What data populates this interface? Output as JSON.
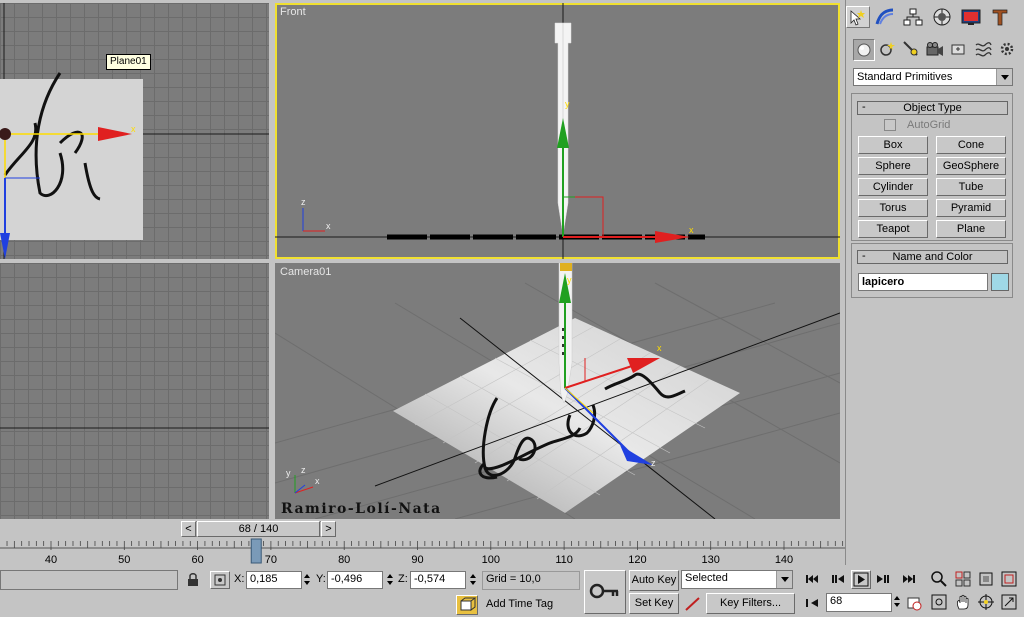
{
  "viewports": {
    "top_left": {
      "object_tooltip": "Plane01"
    },
    "front": {
      "label": "Front"
    },
    "camera": {
      "label": "Camera01",
      "watermark": "Ramiro-Lolí-Nata"
    }
  },
  "axis_letters": {
    "x": "x",
    "y": "y",
    "z": "z"
  },
  "command_panel": {
    "tabs": [
      "create-icon",
      "modify-icon",
      "hierarchy-icon",
      "motion-icon",
      "display-icon",
      "utilities-icon"
    ],
    "subtabs": [
      "geometry-icon",
      "shapes-icon",
      "lights-icon",
      "cameras-icon",
      "helpers-icon",
      "spacewarps-icon",
      "systems-icon"
    ],
    "category": "Standard Primitives",
    "object_type": {
      "title": "Object Type",
      "autogrid": "AutoGrid",
      "buttons": [
        "Box",
        "Cone",
        "Sphere",
        "GeoSphere",
        "Cylinder",
        "Tube",
        "Torus",
        "Pyramid",
        "Teapot",
        "Plane"
      ]
    },
    "name_and_color": {
      "title": "Name and Color",
      "name_value": "lapicero",
      "color": "#9fd8e6"
    },
    "collapse_symbol": "-"
  },
  "timeline": {
    "slider_text": "68 / 140",
    "prev": "<",
    "next": ">",
    "ruler_labels": [
      "40",
      "50",
      "60",
      "70",
      "80",
      "90",
      "100",
      "110",
      "120",
      "130",
      "140"
    ],
    "current_frame": 68
  },
  "status": {
    "x_label": "X:",
    "x_value": "0,185",
    "y_label": "Y:",
    "y_value": "-0,496",
    "z_label": "Z:",
    "z_value": "-0,574",
    "grid": "Grid = 10,0",
    "add_time_tag": "Add Time Tag",
    "auto_key": "Auto Key",
    "set_key": "Set Key",
    "selected": "Selected",
    "key_filters": "Key Filters...",
    "frame_field": "68"
  },
  "colors": {
    "viewport_bg": "#7c7c7c",
    "selected_border": "#f0e030",
    "axis_x": "#e02020",
    "axis_y": "#20a020",
    "axis_z": "#2040e0"
  }
}
